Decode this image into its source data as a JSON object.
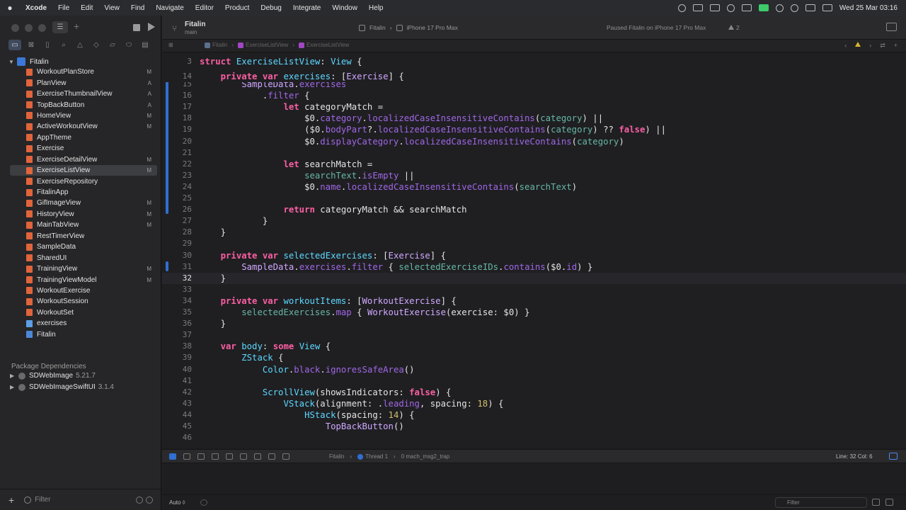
{
  "menubar": {
    "app": "Xcode",
    "items": [
      "File",
      "Edit",
      "View",
      "Find",
      "Navigate",
      "Editor",
      "Product",
      "Debug",
      "Integrate",
      "Window",
      "Help"
    ],
    "datetime": "Wed 25 Mar  03:16"
  },
  "toolbar": {
    "project_title": "Fitalin",
    "branch": "main",
    "scheme": "Fitalin",
    "destination": "iPhone 17 Pro Max",
    "status": "Paused Fitalin on iPhone 17 Pro Max",
    "warnings": "2"
  },
  "jumpbar": {
    "crumbs": [
      "Fitalin",
      "ExerciseListView",
      "ExerciseListView"
    ]
  },
  "navigator": {
    "project": "Fitalin",
    "files": [
      {
        "name": "WorkoutPlanStore",
        "status": "M"
      },
      {
        "name": "PlanView",
        "status": "A"
      },
      {
        "name": "ExerciseThumbnailView",
        "status": "A"
      },
      {
        "name": "TopBackButton",
        "status": "A"
      },
      {
        "name": "HomeView",
        "status": "M"
      },
      {
        "name": "ActiveWorkoutView",
        "status": "M"
      },
      {
        "name": "AppTheme",
        "status": ""
      },
      {
        "name": "Exercise",
        "status": ""
      },
      {
        "name": "ExerciseDetailView",
        "status": "M"
      },
      {
        "name": "ExerciseListView",
        "status": "M"
      },
      {
        "name": "ExerciseRepository",
        "status": ""
      },
      {
        "name": "FitalinApp",
        "status": ""
      },
      {
        "name": "GifImageView",
        "status": "M"
      },
      {
        "name": "HistoryView",
        "status": "M"
      },
      {
        "name": "MainTabView",
        "status": "M"
      },
      {
        "name": "RestTimerView",
        "status": ""
      },
      {
        "name": "SampleData",
        "status": ""
      },
      {
        "name": "SharedUI",
        "status": ""
      },
      {
        "name": "TrainingView",
        "status": "M"
      },
      {
        "name": "TrainingViewModel",
        "status": "M"
      },
      {
        "name": "WorkoutExercise",
        "status": ""
      },
      {
        "name": "WorkoutSession",
        "status": ""
      },
      {
        "name": "WorkoutSet",
        "status": ""
      },
      {
        "name": "exercises",
        "status": ""
      },
      {
        "name": "Fitalin",
        "status": ""
      }
    ],
    "package_header": "Package Dependencies",
    "packages": [
      {
        "name": "SDWebImage",
        "version": "5.21.7"
      },
      {
        "name": "SDWebImageSwiftUI",
        "version": "3.1.4"
      }
    ],
    "filter_placeholder": "Filter"
  },
  "editor": {
    "lines": [
      {
        "n": "3",
        "tokens": [
          [
            "kw",
            "struct "
          ],
          [
            "dec",
            "ExerciseListView"
          ],
          [
            "plain",
            ": "
          ],
          [
            "ty",
            "View"
          ],
          [
            "plain",
            " {"
          ]
        ]
      },
      {
        "n": "14",
        "tokens": [
          [
            "plain",
            "    "
          ],
          [
            "kw",
            "private var "
          ],
          [
            "dec",
            "exercises"
          ],
          [
            "plain",
            ": ["
          ],
          [
            "tyc",
            "Exercise"
          ],
          [
            "plain",
            "] {"
          ]
        ]
      },
      {
        "n": "15",
        "tokens": [
          [
            "plain",
            "        "
          ],
          [
            "tyc",
            "SampleData"
          ],
          [
            "plain",
            "."
          ],
          [
            "prop",
            "exercises"
          ]
        ]
      },
      {
        "n": "16",
        "tokens": [
          [
            "plain",
            "            ."
          ],
          [
            "prop",
            "filter"
          ],
          [
            "plain",
            " {"
          ]
        ]
      },
      {
        "n": "17",
        "tokens": [
          [
            "plain",
            "                "
          ],
          [
            "kw",
            "let "
          ],
          [
            "plain",
            "categoryMatch ="
          ]
        ]
      },
      {
        "n": "18",
        "tokens": [
          [
            "plain",
            "                    $0."
          ],
          [
            "prop",
            "category"
          ],
          [
            "plain",
            "."
          ],
          [
            "prop",
            "localizedCaseInsensitiveContains"
          ],
          [
            "plain",
            "("
          ],
          [
            "fn",
            "category"
          ],
          [
            "plain",
            ") ||"
          ]
        ]
      },
      {
        "n": "19",
        "tokens": [
          [
            "plain",
            "                    ($0."
          ],
          [
            "prop",
            "bodyPart"
          ],
          [
            "plain",
            "?."
          ],
          [
            "prop",
            "localizedCaseInsensitiveContains"
          ],
          [
            "plain",
            "("
          ],
          [
            "fn",
            "category"
          ],
          [
            "plain",
            ") ?? "
          ],
          [
            "kw",
            "false"
          ],
          [
            "plain",
            ") ||"
          ]
        ]
      },
      {
        "n": "20",
        "tokens": [
          [
            "plain",
            "                    $0."
          ],
          [
            "prop",
            "displayCategory"
          ],
          [
            "plain",
            "."
          ],
          [
            "prop",
            "localizedCaseInsensitiveContains"
          ],
          [
            "plain",
            "("
          ],
          [
            "fn",
            "category"
          ],
          [
            "plain",
            ")"
          ]
        ]
      },
      {
        "n": "21",
        "tokens": []
      },
      {
        "n": "22",
        "tokens": [
          [
            "plain",
            "                "
          ],
          [
            "kw",
            "let "
          ],
          [
            "plain",
            "searchMatch ="
          ]
        ]
      },
      {
        "n": "23",
        "tokens": [
          [
            "plain",
            "                    "
          ],
          [
            "fn",
            "searchText"
          ],
          [
            "plain",
            "."
          ],
          [
            "prop",
            "isEmpty"
          ],
          [
            "plain",
            " ||"
          ]
        ]
      },
      {
        "n": "24",
        "tokens": [
          [
            "plain",
            "                    $0."
          ],
          [
            "prop",
            "name"
          ],
          [
            "plain",
            "."
          ],
          [
            "prop",
            "localizedCaseInsensitiveContains"
          ],
          [
            "plain",
            "("
          ],
          [
            "fn",
            "searchText"
          ],
          [
            "plain",
            ")"
          ]
        ]
      },
      {
        "n": "25",
        "tokens": []
      },
      {
        "n": "26",
        "tokens": [
          [
            "plain",
            "                "
          ],
          [
            "kw",
            "return "
          ],
          [
            "plain",
            "categoryMatch && searchMatch"
          ]
        ]
      },
      {
        "n": "27",
        "tokens": [
          [
            "plain",
            "            }"
          ]
        ]
      },
      {
        "n": "28",
        "tokens": [
          [
            "plain",
            "    }"
          ]
        ]
      },
      {
        "n": "29",
        "tokens": []
      },
      {
        "n": "30",
        "tokens": [
          [
            "plain",
            "    "
          ],
          [
            "kw",
            "private var "
          ],
          [
            "dec",
            "selectedExercises"
          ],
          [
            "plain",
            ": ["
          ],
          [
            "tyc",
            "Exercise"
          ],
          [
            "plain",
            "] {"
          ]
        ]
      },
      {
        "n": "31",
        "tokens": [
          [
            "plain",
            "        "
          ],
          [
            "tyc",
            "SampleData"
          ],
          [
            "plain",
            "."
          ],
          [
            "prop",
            "exercises"
          ],
          [
            "plain",
            "."
          ],
          [
            "prop",
            "filter"
          ],
          [
            "plain",
            " { "
          ],
          [
            "fn",
            "selectedExerciseIDs"
          ],
          [
            "plain",
            "."
          ],
          [
            "prop",
            "contains"
          ],
          [
            "plain",
            "($0."
          ],
          [
            "prop",
            "id"
          ],
          [
            "plain",
            ") }"
          ]
        ]
      },
      {
        "n": "32",
        "tokens": [
          [
            "plain",
            "    }"
          ]
        ]
      },
      {
        "n": "33",
        "tokens": []
      },
      {
        "n": "34",
        "tokens": [
          [
            "plain",
            "    "
          ],
          [
            "kw",
            "private var "
          ],
          [
            "dec",
            "workoutItems"
          ],
          [
            "plain",
            ": ["
          ],
          [
            "tyc",
            "WorkoutExercise"
          ],
          [
            "plain",
            "] {"
          ]
        ]
      },
      {
        "n": "35",
        "tokens": [
          [
            "plain",
            "        "
          ],
          [
            "fn",
            "selectedExercises"
          ],
          [
            "plain",
            "."
          ],
          [
            "prop",
            "map"
          ],
          [
            "plain",
            " { "
          ],
          [
            "tyc",
            "WorkoutExercise"
          ],
          [
            "plain",
            "(exercise: $0) }"
          ]
        ]
      },
      {
        "n": "36",
        "tokens": [
          [
            "plain",
            "    }"
          ]
        ]
      },
      {
        "n": "37",
        "tokens": []
      },
      {
        "n": "38",
        "tokens": [
          [
            "plain",
            "    "
          ],
          [
            "kw",
            "var "
          ],
          [
            "dec",
            "body"
          ],
          [
            "plain",
            ": "
          ],
          [
            "kw",
            "some "
          ],
          [
            "ty",
            "View"
          ],
          [
            "plain",
            " {"
          ]
        ]
      },
      {
        "n": "39",
        "tokens": [
          [
            "plain",
            "        "
          ],
          [
            "ty",
            "ZStack"
          ],
          [
            "plain",
            " {"
          ]
        ]
      },
      {
        "n": "40",
        "tokens": [
          [
            "plain",
            "            "
          ],
          [
            "ty",
            "Color"
          ],
          [
            "plain",
            "."
          ],
          [
            "prop",
            "black"
          ],
          [
            "plain",
            "."
          ],
          [
            "prop",
            "ignoresSafeArea"
          ],
          [
            "plain",
            "()"
          ]
        ]
      },
      {
        "n": "41",
        "tokens": []
      },
      {
        "n": "42",
        "tokens": [
          [
            "plain",
            "            "
          ],
          [
            "ty",
            "ScrollView"
          ],
          [
            "plain",
            "(showsIndicators: "
          ],
          [
            "kw",
            "false"
          ],
          [
            "plain",
            ") {"
          ]
        ]
      },
      {
        "n": "43",
        "tokens": [
          [
            "plain",
            "                "
          ],
          [
            "ty",
            "VStack"
          ],
          [
            "plain",
            "(alignment: ."
          ],
          [
            "prop",
            "leading"
          ],
          [
            "plain",
            ", spacing: "
          ],
          [
            "num",
            "18"
          ],
          [
            "plain",
            ") {"
          ]
        ]
      },
      {
        "n": "44",
        "tokens": [
          [
            "plain",
            "                    "
          ],
          [
            "ty",
            "HStack"
          ],
          [
            "plain",
            "(spacing: "
          ],
          [
            "num",
            "14"
          ],
          [
            "plain",
            ") {"
          ]
        ]
      },
      {
        "n": "45",
        "tokens": [
          [
            "plain",
            "                        "
          ],
          [
            "tyc",
            "TopBackButton"
          ],
          [
            "plain",
            "()"
          ]
        ]
      },
      {
        "n": "46",
        "tokens": []
      }
    ]
  },
  "debugbar": {
    "crumbs": [
      "Fitalin",
      "Thread 1",
      "0 mach_msg2_trap"
    ],
    "cursor": "Line: 32  Col: 6"
  },
  "console": {
    "mode": "Auto ◊",
    "filter_placeholder": "Filter"
  }
}
